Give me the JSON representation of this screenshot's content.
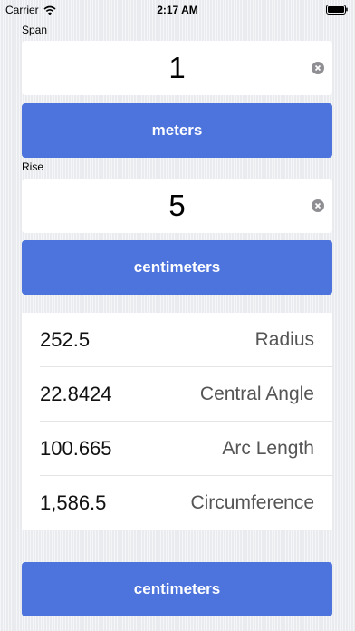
{
  "status_bar": {
    "carrier": "Carrier",
    "time": "2:17 AM",
    "icons": [
      "wifi-icon",
      "battery-icon"
    ]
  },
  "span": {
    "label": "Span",
    "value": "1",
    "unit": "meters"
  },
  "rise": {
    "label": "Rise",
    "value": "5",
    "unit": "centimeters"
  },
  "results": [
    {
      "value": "252.5",
      "label": "Radius"
    },
    {
      "value": "22.8424",
      "label": "Central Angle"
    },
    {
      "value": "100.665",
      "label": "Arc Length"
    },
    {
      "value": "1,586.5",
      "label": "Circumference"
    }
  ],
  "output_unit": "centimeters",
  "colors": {
    "accent": "#4d73dc",
    "background": "#e9ebee",
    "result_label": "#555555"
  }
}
